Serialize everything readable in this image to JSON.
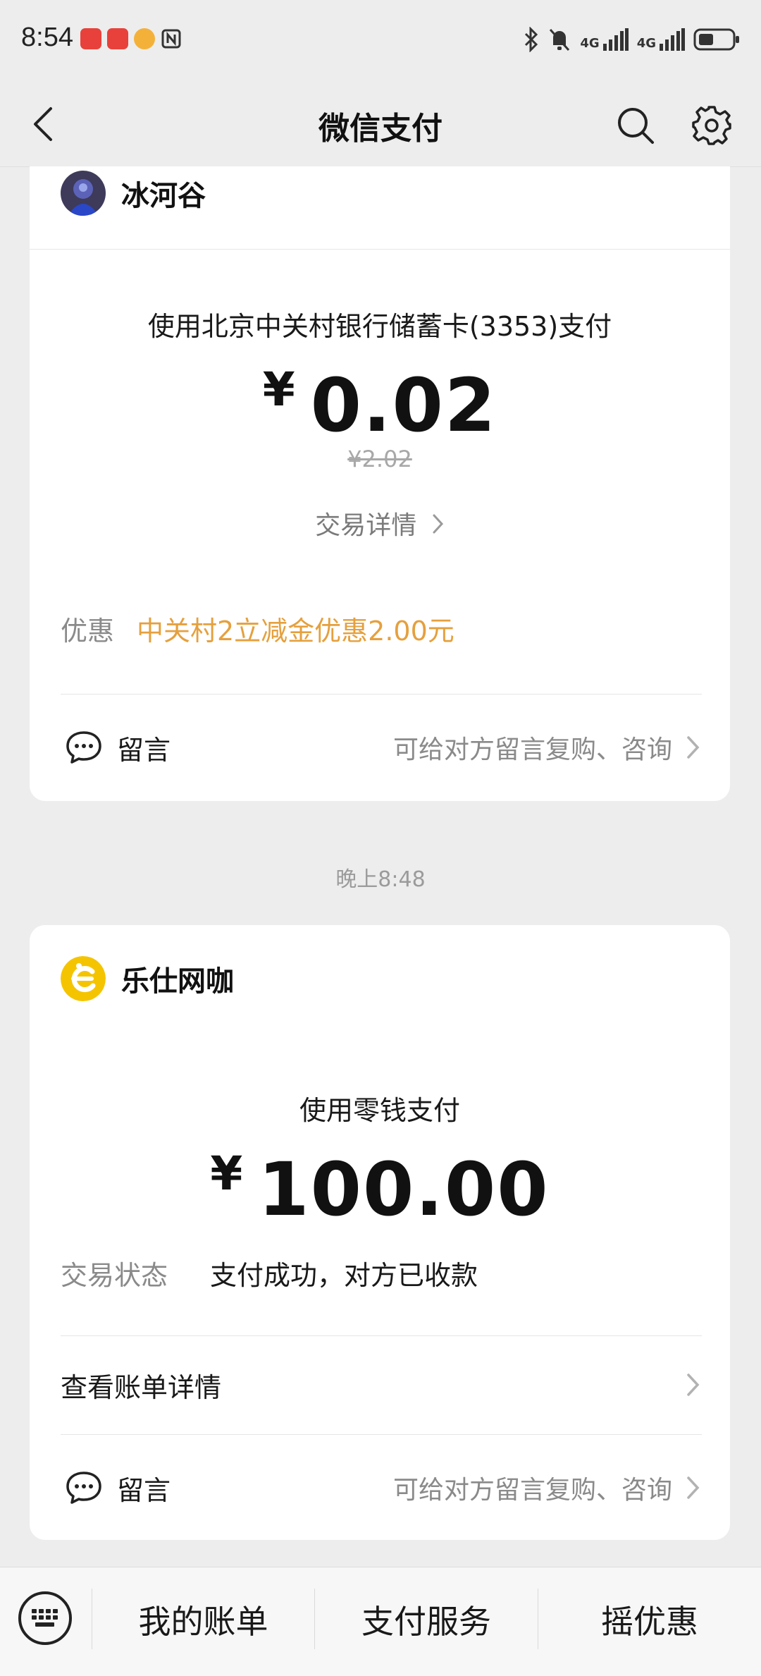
{
  "status_bar": {
    "time": "8:54",
    "network_1": "4G",
    "network_2": "4G"
  },
  "nav": {
    "title": "微信支付"
  },
  "transactions": [
    {
      "merchant": "冰河谷",
      "pay_method": "使用北京中关村银行储蓄卡(3353)支付",
      "currency": "¥",
      "amount": "0.02",
      "original_amount": "¥2.02",
      "detail_link": "交易详情",
      "discount_label": "优惠",
      "discount_value": "中关村2立减金优惠2.00元",
      "message_label": "留言",
      "message_hint": "可给对方留言复购、咨询"
    },
    {
      "merchant": "乐仕网咖",
      "pay_method": "使用零钱支付",
      "currency": "¥",
      "amount": "100.00",
      "status_label": "交易状态",
      "status_value": "支付成功，对方已收款",
      "bill_detail_label": "查看账单详情",
      "message_label": "留言",
      "message_hint": "可给对方留言复购、咨询"
    }
  ],
  "timestamp": "晚上8:48",
  "bottom_bar": {
    "items": [
      "我的账单",
      "支付服务",
      "摇优惠"
    ]
  },
  "colors": {
    "background": "#ededed",
    "card": "#ffffff",
    "discount": "#e5a03e",
    "secondary_text": "#8a8a8a"
  },
  "icons": {
    "back": "chevron-left-icon",
    "search": "search-icon",
    "settings": "gear-icon",
    "message": "chat-bubble-icon",
    "chevron": "chevron-right-icon",
    "keyboard": "keyboard-icon"
  }
}
